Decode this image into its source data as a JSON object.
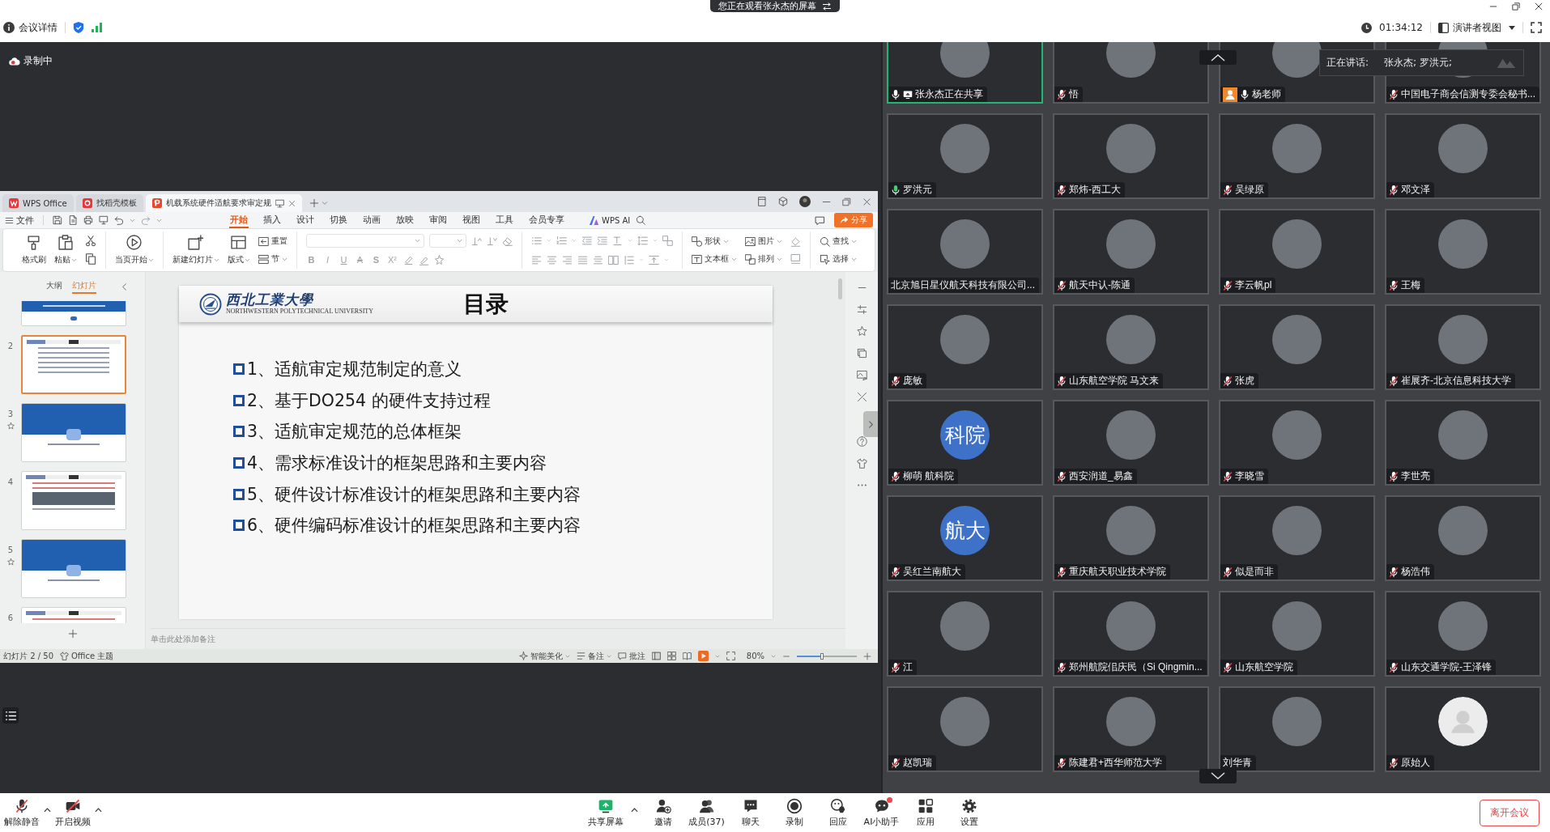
{
  "top_banner": {
    "text": "您正在观看张永杰的屏幕"
  },
  "meeting_bar": {
    "details": "会议详情",
    "timer": "01:34:12",
    "view_mode": "演讲者视图"
  },
  "recording": {
    "label": "录制中"
  },
  "wps": {
    "tabs": [
      {
        "label": "WPS Office",
        "kind": "home",
        "selected": false
      },
      {
        "label": "找稻壳模板",
        "kind": "template",
        "selected": false
      },
      {
        "label": "机载系统硬件适航要求审定规",
        "kind": "document",
        "selected": true
      }
    ],
    "file_menu": "文件",
    "ribbon_tabs": [
      {
        "label": "开始",
        "selected": true
      },
      {
        "label": "插入",
        "selected": false
      },
      {
        "label": "设计",
        "selected": false
      },
      {
        "label": "切换",
        "selected": false
      },
      {
        "label": "动画",
        "selected": false
      },
      {
        "label": "放映",
        "selected": false
      },
      {
        "label": "审阅",
        "selected": false
      },
      {
        "label": "视图",
        "selected": false
      },
      {
        "label": "工具",
        "selected": false
      },
      {
        "label": "会员专享",
        "selected": false
      }
    ],
    "ai_button": "WPS AI",
    "share_button": "分享",
    "ribbon": {
      "format_painter": "格式刷",
      "paste": "粘贴",
      "play_current": "当页开始",
      "new_slide": "新建幻灯片",
      "layout": "版式",
      "reset": "重置",
      "section": "节",
      "font_styles": [
        "B",
        "I",
        "U",
        "A",
        "S",
        "X²"
      ],
      "shape": "形状",
      "picture": "图片",
      "text_box": "文本框",
      "arrange": "排列",
      "find": "查找",
      "select": "选择"
    },
    "slide_panel": {
      "tabs": [
        {
          "label": "大纲",
          "selected": false
        },
        {
          "label": "幻灯片",
          "selected": true
        }
      ],
      "thumbnails": [
        {
          "kind": "cover",
          "selected": false,
          "animated": false
        },
        {
          "number": "2",
          "kind": "contents",
          "selected": true,
          "animated": false
        },
        {
          "number": "3",
          "kind": "section",
          "selected": false,
          "animated": true
        },
        {
          "number": "4",
          "kind": "content",
          "selected": false,
          "animated": false
        },
        {
          "number": "5",
          "kind": "section",
          "selected": false,
          "animated": true
        },
        {
          "number": "6",
          "kind": "content",
          "selected": false,
          "animated": false
        }
      ]
    },
    "slide": {
      "university_name": "西北工業大學",
      "university_name_en": "NORTHWESTERN POLYTECHNICAL UNIVERSITY",
      "title": "目录",
      "items": [
        "1、适航审定规范制定的意义",
        "2、基于DO254 的硬件支持过程",
        "3、适航审定规范的总体框架",
        "4、需求标准设计的框架思路和主要内容",
        "5、硬件设计标准设计的框架思路和主要内容",
        "6、硬件编码标准设计的框架思路和主要内容"
      ]
    },
    "notes_placeholder": "单击此处添加备注",
    "status_bar": {
      "slide_counter": "幻灯片 2 / 50",
      "theme": "Office 主题",
      "beautify": "智能美化",
      "notes": "备注",
      "comments": "批注",
      "zoom": "80%",
      "zoom_slider": {
        "level": 0.42
      }
    }
  },
  "speaking_tooltip": {
    "label": "正在讲话:",
    "names": "张永杰; 罗洪元;"
  },
  "participants": [
    {
      "name": "张永杰正在共享",
      "mic": {
        "kind": "on"
      },
      "badge": {
        "kind": "sharing"
      },
      "avatar": {
        "kind": "photo"
      },
      "active": true
    },
    {
      "name": "悟",
      "mic": {
        "kind": "muted"
      },
      "avatar": {
        "kind": "photo"
      },
      "active": false
    },
    {
      "name": "杨老师",
      "mic": {
        "kind": "on"
      },
      "badge": {
        "kind": "host"
      },
      "avatar": {
        "kind": "photo"
      },
      "active": false
    },
    {
      "name": "中国电子商会信测专委会秘书...",
      "mic": {
        "kind": "muted"
      },
      "avatar": {
        "kind": "photo"
      },
      "active": false
    },
    {
      "name": "罗洪元",
      "mic": {
        "kind": "speaking"
      },
      "avatar": {
        "kind": "photo"
      },
      "active": false
    },
    {
      "name": "郑炜-西工大",
      "mic": {
        "kind": "muted"
      },
      "avatar": {
        "kind": "photo"
      },
      "active": false
    },
    {
      "name": "吴绿原",
      "mic": {
        "kind": "muted"
      },
      "avatar": {
        "kind": "photo"
      },
      "active": false
    },
    {
      "name": "邓文泽",
      "mic": {
        "kind": "muted"
      },
      "avatar": {
        "kind": "photo"
      },
      "active": false
    },
    {
      "name": "北京旭日星仪航天科技有限公司...",
      "avatar": {
        "kind": "photo"
      },
      "active": false
    },
    {
      "name": "航天中认-陈通",
      "mic": {
        "kind": "muted"
      },
      "avatar": {
        "kind": "photo"
      },
      "active": false
    },
    {
      "name": "李云帆pl",
      "mic": {
        "kind": "muted"
      },
      "avatar": {
        "kind": "photo"
      },
      "active": false
    },
    {
      "name": "王梅",
      "mic": {
        "kind": "muted"
      },
      "avatar": {
        "kind": "photo"
      },
      "active": false
    },
    {
      "name": "庞敏",
      "mic": {
        "kind": "muted"
      },
      "avatar": {
        "kind": "photo"
      },
      "active": false
    },
    {
      "name": "山东航空学院 马文来",
      "mic": {
        "kind": "muted"
      },
      "avatar": {
        "kind": "photo"
      },
      "active": false
    },
    {
      "name": "张虎",
      "mic": {
        "kind": "muted"
      },
      "avatar": {
        "kind": "photo"
      },
      "active": false
    },
    {
      "name": "崔展齐-北京信息科技大学",
      "mic": {
        "kind": "muted"
      },
      "avatar": {
        "kind": "photo"
      },
      "active": false
    },
    {
      "name": "柳萌 航科院",
      "mic": {
        "kind": "muted"
      },
      "avatar": {
        "kind": "text",
        "text": "科院"
      },
      "active": false
    },
    {
      "name": "西安润道_易鑫",
      "mic": {
        "kind": "muted"
      },
      "avatar": {
        "kind": "photo"
      },
      "active": false
    },
    {
      "name": "李晓雪",
      "mic": {
        "kind": "muted"
      },
      "avatar": {
        "kind": "photo"
      },
      "active": false
    },
    {
      "name": "李世亮",
      "mic": {
        "kind": "muted"
      },
      "avatar": {
        "kind": "photo"
      },
      "active": false
    },
    {
      "name": "吴红兰南航大",
      "mic": {
        "kind": "muted"
      },
      "avatar": {
        "kind": "text",
        "text": "航大"
      },
      "active": false
    },
    {
      "name": "重庆航天职业技术学院",
      "mic": {
        "kind": "muted"
      },
      "avatar": {
        "kind": "photo"
      },
      "active": false
    },
    {
      "name": "似是而非",
      "mic": {
        "kind": "muted"
      },
      "avatar": {
        "kind": "photo"
      },
      "active": false
    },
    {
      "name": "杨浩伟",
      "mic": {
        "kind": "muted"
      },
      "avatar": {
        "kind": "photo"
      },
      "active": false
    },
    {
      "name": "江",
      "mic": {
        "kind": "muted"
      },
      "avatar": {
        "kind": "photo"
      },
      "active": false
    },
    {
      "name": "郑州航院佀庆民（Si Qingmin...",
      "mic": {
        "kind": "muted"
      },
      "avatar": {
        "kind": "photo"
      },
      "active": false
    },
    {
      "name": "山东航空学院",
      "mic": {
        "kind": "muted"
      },
      "avatar": {
        "kind": "photo"
      },
      "active": false
    },
    {
      "name": "山东交通学院-王泽锋",
      "mic": {
        "kind": "muted"
      },
      "avatar": {
        "kind": "photo"
      },
      "active": false
    },
    {
      "name": "赵凯瑞",
      "mic": {
        "kind": "muted"
      },
      "avatar": {
        "kind": "photo"
      },
      "active": false
    },
    {
      "name": "陈建君+西华师范大学",
      "mic": {
        "kind": "muted"
      },
      "avatar": {
        "kind": "photo"
      },
      "active": false
    },
    {
      "name": "刘华青",
      "avatar": {
        "kind": "photo"
      },
      "active": false
    },
    {
      "name": "原始人",
      "mic": {
        "kind": "muted"
      },
      "avatar": {
        "kind": "default"
      },
      "active": false
    }
  ],
  "toolbar": {
    "left": [
      {
        "label": "解除静音",
        "kind": "mic",
        "menu": true
      },
      {
        "label": "开启视频",
        "kind": "camera",
        "menu": true
      }
    ],
    "center": [
      {
        "label": "共享屏幕",
        "kind": "share",
        "menu": true,
        "notification": false
      },
      {
        "label": "邀请",
        "kind": "invite",
        "menu": false,
        "notification": false
      },
      {
        "label": "成员(37)",
        "kind": "members",
        "menu": false,
        "notification": false
      },
      {
        "label": "聊天",
        "kind": "chat",
        "menu": false,
        "notification": false
      },
      {
        "label": "录制",
        "kind": "record",
        "menu": false,
        "notification": false
      },
      {
        "label": "回应",
        "kind": "react",
        "menu": false,
        "notification": false
      },
      {
        "label": "AI小助手",
        "kind": "assistant",
        "menu": false,
        "notification": true
      },
      {
        "label": "应用",
        "kind": "apps",
        "menu": false,
        "notification": false
      },
      {
        "label": "设置",
        "kind": "settings",
        "menu": false,
        "notification": false
      }
    ],
    "leave_button": "离开会议"
  }
}
